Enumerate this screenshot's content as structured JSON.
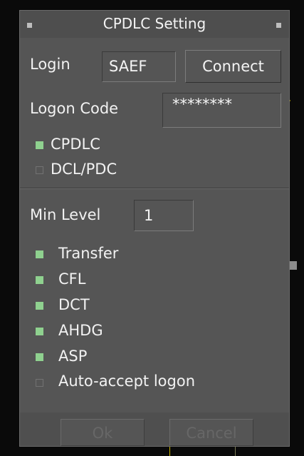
{
  "window": {
    "title": "CPDLC Setting"
  },
  "login": {
    "label": "Login",
    "value": "SAEF",
    "connect_label": "Connect"
  },
  "logon_code": {
    "label": "Logon Code",
    "value": "********"
  },
  "modes": [
    {
      "label": "CPDLC",
      "checked": true
    },
    {
      "label": "DCL/PDC",
      "checked": false
    }
  ],
  "min_level": {
    "label": "Min Level",
    "value": "1"
  },
  "options": [
    {
      "label": "Transfer",
      "checked": true
    },
    {
      "label": "CFL",
      "checked": true
    },
    {
      "label": "DCT",
      "checked": true
    },
    {
      "label": "AHDG",
      "checked": true
    },
    {
      "label": "ASP",
      "checked": true
    },
    {
      "label": "Auto-accept logon",
      "checked": false
    }
  ],
  "footer": {
    "ok_label": "Ok",
    "cancel_label": "Cancel"
  },
  "colors": {
    "window_bg": "#555555",
    "checkbox_on": "#8fd18f",
    "background_line": "#c8b400"
  }
}
